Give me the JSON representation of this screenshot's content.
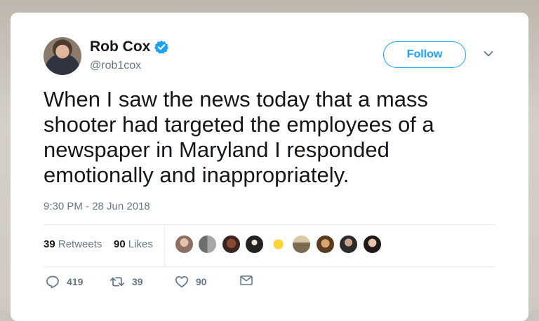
{
  "tweet": {
    "author_name": "Rob Cox",
    "handle": "@rob1cox",
    "follow_label": "Follow",
    "text": "When I saw the news today that a mass shooter had targeted the employees of a newspaper in Maryland I responded emotionally and inappropriately.",
    "timestamp": "9:30 PM - 28 Jun 2018",
    "accent_color": "#1da1f2"
  },
  "stats": {
    "retweets_count": "39",
    "retweets_label": "Retweets",
    "likes_count": "90",
    "likes_label": "Likes"
  },
  "actions": {
    "reply_count": "419",
    "retweet_count": "39",
    "like_count": "90"
  },
  "icons": {
    "verified": "verified-badge-icon",
    "more": "chevron-down-icon",
    "reply": "reply-icon",
    "retweet": "retweet-icon",
    "like": "heart-icon",
    "message": "direct-message-icon"
  }
}
